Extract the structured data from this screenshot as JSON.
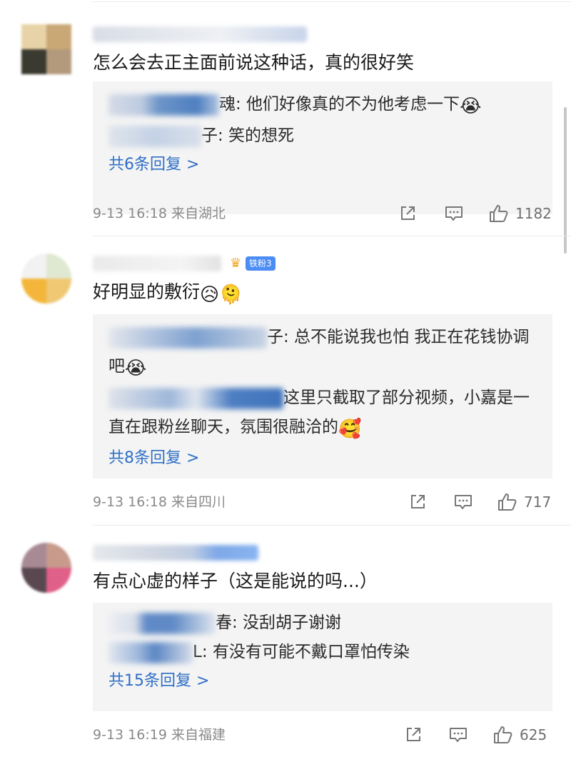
{
  "comments": [
    {
      "text": "怎么会去正主面前说这种话，真的很好笑",
      "emojis": [],
      "avatar_colors": [
        "#e8d3a8",
        "#c9a876",
        "#3a3a30",
        "#b39a7c"
      ],
      "avatar_round": false,
      "name_blur_color": "#d6dbe6",
      "badge": null,
      "replies": [
        {
          "tail": "魂: 他们好像真的不为他考虑一下",
          "emoji": "😭"
        },
        {
          "tail": "子: 笑的想死",
          "emoji": ""
        }
      ],
      "more": "共6条回复 >",
      "time": "9-13 16:18 来自湖北",
      "likes": "1182"
    },
    {
      "text": "好明显的敷衍",
      "emojis": [
        "😥",
        "🫠"
      ],
      "avatar_colors": [
        "#f2f2f2",
        "#dfe8d0",
        "#f3b63a",
        "#f0c874"
      ],
      "avatar_round": true,
      "name_blur_color": "#e5e5e5",
      "badge": {
        "crown": "♛",
        "label": "铁粉3"
      },
      "replies": [
        {
          "tail": "子: 总不能说我也怕 我正在花钱协调吧",
          "emoji": "😭"
        },
        {
          "tail": "这里只截取了部分视频，小嘉是一直在跟粉丝聊天，氛围很融洽的",
          "emoji": "🥰"
        }
      ],
      "more": "共8条回复 >",
      "time": "9-13 16:18 来自四川",
      "likes": "717"
    },
    {
      "text": "有点心虚的样子（这是能说的吗...）",
      "emojis": [],
      "avatar_colors": [
        "#a88a94",
        "#c79a8c",
        "#5a4850",
        "#e0608a"
      ],
      "avatar_round": true,
      "name_blur_color": "#c9d3e3",
      "badge": null,
      "replies": [
        {
          "tail": "春: 没刮胡子谢谢",
          "emoji": ""
        },
        {
          "tail": "L: 有没有可能不戴口罩怕传染",
          "emoji": ""
        }
      ],
      "more": "共15条回复 >",
      "time": "9-13 16:19 来自福建",
      "likes": "625"
    }
  ],
  "icons": {
    "share": "share-icon",
    "comment": "comment-icon",
    "like": "thumbs-up-icon"
  },
  "colors": {
    "link": "#2f6fc6",
    "reply_bg": "#f4f4f4",
    "meta": "#8a8a8a"
  }
}
